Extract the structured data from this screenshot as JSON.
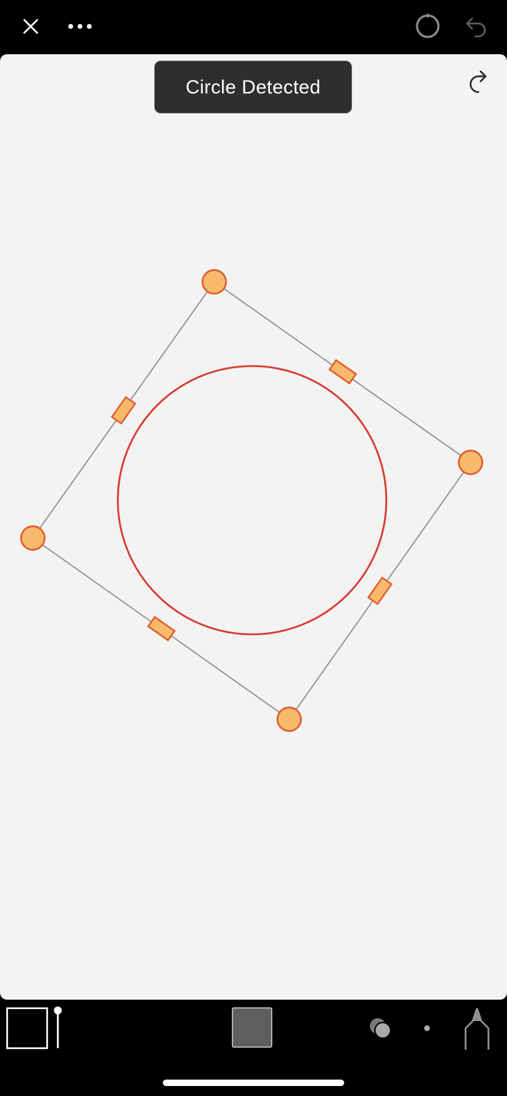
{
  "toast": {
    "message": "Circle Detected"
  },
  "topbar": {
    "close_icon": "close-icon",
    "more_icon": "more-dots-icon",
    "reset_icon": "refresh-circle-icon",
    "undo_icon": "undo-icon"
  },
  "canvas": {
    "redo_icon": "redo-icon",
    "background_color": "#f3f3f2",
    "circle_color": "#d83a32",
    "handle_fill": "#f7b96b",
    "handle_stroke": "#e2582a"
  },
  "bottombar": {
    "canvas_tool_icon": "canvas-frame-icon",
    "brush_size_icon": "brush-size-icon",
    "color_swatch": "#5e5e5e",
    "blend_icon": "blend-circles-icon",
    "dot_size_icon": "dot-icon",
    "pen_tool_icon": "fountain-pen-icon"
  }
}
